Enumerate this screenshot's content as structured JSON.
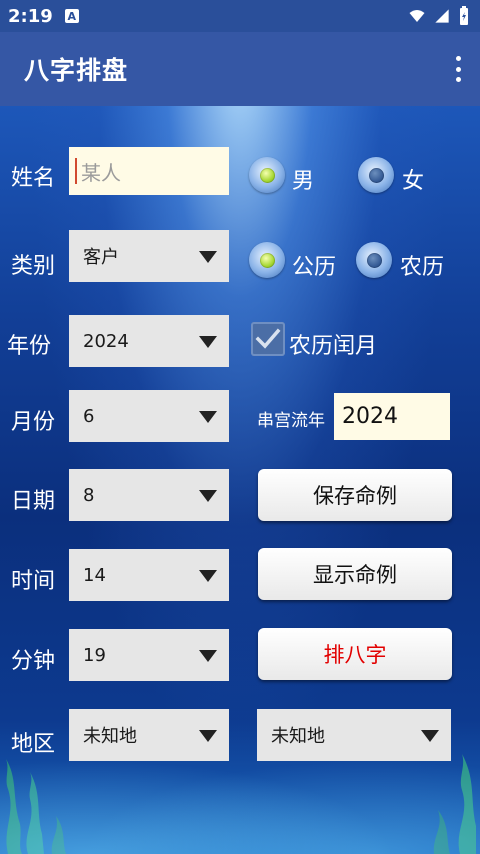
{
  "status": {
    "time": "2:19",
    "notif_letter": "A"
  },
  "app": {
    "title": "八字排盘"
  },
  "form": {
    "name": {
      "label": "姓名",
      "placeholder": "某人"
    },
    "gender": {
      "male": "男",
      "female": "女",
      "selected": "男"
    },
    "category": {
      "label": "类别",
      "value": "客户"
    },
    "calendar": {
      "solar": "公历",
      "lunar": "农历",
      "selected": "公历"
    },
    "year": {
      "label": "年份",
      "value": "2024"
    },
    "leap": {
      "label": "农历闰月",
      "checked": true
    },
    "month": {
      "label": "月份",
      "value": "6"
    },
    "palace": {
      "label": "串宫流年",
      "value": "2024"
    },
    "day": {
      "label": "日期",
      "value": "8"
    },
    "save_button": "保存命例",
    "hour": {
      "label": "时间",
      "value": "14"
    },
    "show_button": "显示命例",
    "minute": {
      "label": "分钟",
      "value": "19"
    },
    "paipan_button": "排八字",
    "region": {
      "label": "地区",
      "value1": "未知地",
      "value2": "未知地"
    }
  },
  "colors": {
    "appbar": "#3557a5",
    "statusbar": "#2a4f9a",
    "input_bg": "#fffbe6",
    "accent_red": "#e20000"
  }
}
